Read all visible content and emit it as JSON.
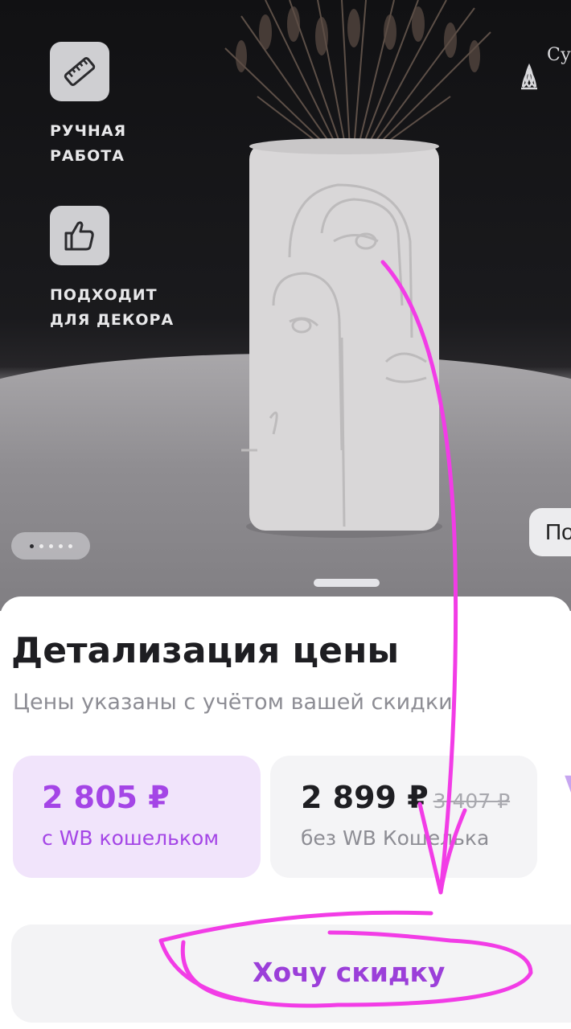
{
  "gallery": {
    "features": [
      {
        "icon": "ruler-icon",
        "label": "РУЧНАЯ\nРАБОТА"
      },
      {
        "icon": "thumbs-up-icon",
        "label": "ПОДХОДИТ\nДЛЯ ДЕКОРА"
      }
    ],
    "brand_text": "Су",
    "side_chip_label": "По",
    "dots_total": 5,
    "active_dot": 1
  },
  "sheet": {
    "title": "Детализация цены",
    "subtitle": "Цены указаны с учётом вашей скидки",
    "wallet_price": {
      "amount": "2 805 ₽",
      "caption": "с WB кошельком"
    },
    "regular_price": {
      "amount": "2 899 ₽",
      "old_amount": "3 407 ₽",
      "caption": "без WB Кошелька"
    },
    "next_card_letter": "V",
    "discount_button_label": "Хочу скидку"
  },
  "colors": {
    "accent_purple": "#a445e6",
    "wallet_card_bg": "#f1e4fb",
    "annotation_pink": "#f23ce6"
  }
}
